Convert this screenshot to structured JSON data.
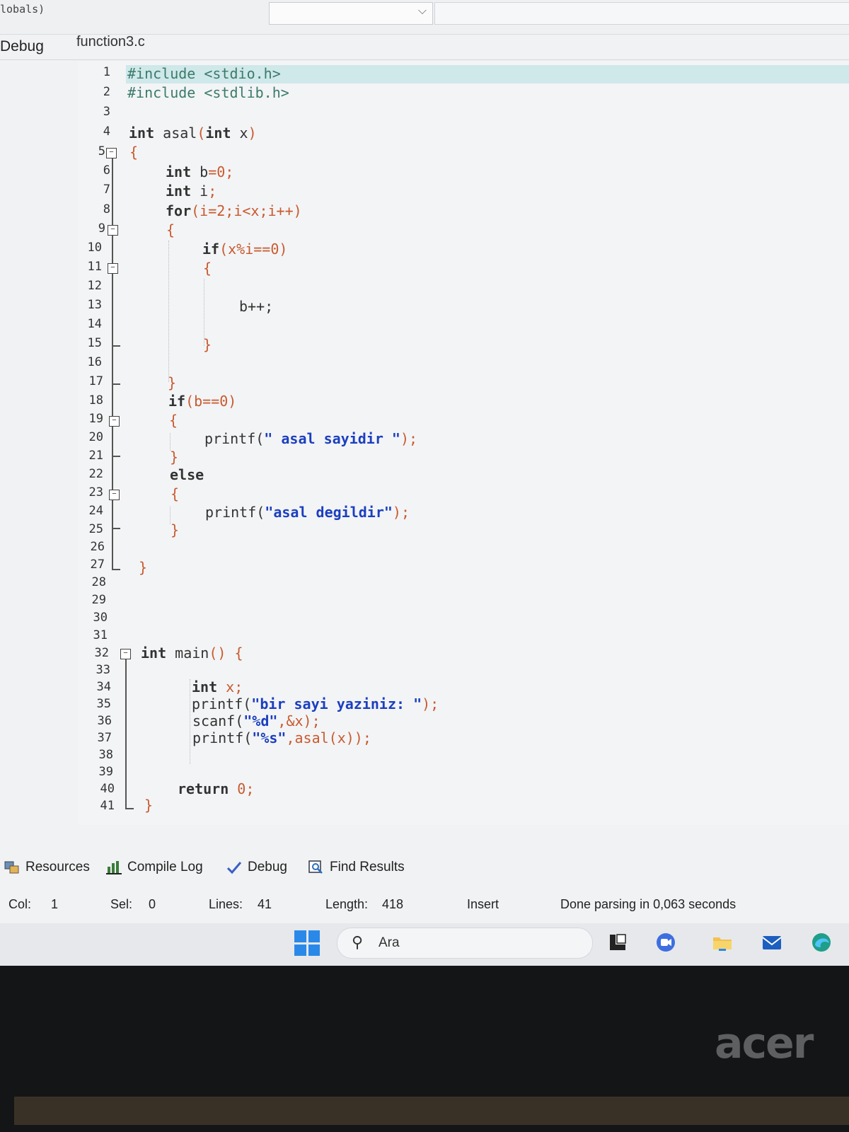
{
  "top": {
    "scope_text": "lobals)",
    "dropdown_arrow": "chevron-down-icon"
  },
  "left_panel": {
    "tab_label": "Debug"
  },
  "editor": {
    "file_tab": "function3.c",
    "line_numbers": [
      "1",
      "2",
      "3",
      "4",
      "5",
      "6",
      "7",
      "8",
      "9",
      "10",
      "11",
      "12",
      "13",
      "14",
      "15",
      "16",
      "17",
      "18",
      "19",
      "20",
      "21",
      "22",
      "23",
      "24",
      "25",
      "26",
      "27",
      "28",
      "29",
      "30",
      "31",
      "32",
      "33",
      "34",
      "35",
      "36",
      "37",
      "38",
      "39",
      "40",
      "41"
    ],
    "code": {
      "l1_pre": "#include <stdio.h>",
      "l2_pre": "#include <stdlib.h>",
      "l4_kw": "int",
      "l4_name": " asal",
      "l4_paren_open": "(",
      "l4_arg_kw": "int",
      "l4_arg": " x",
      "l4_paren_close": ")",
      "brace_open": "{",
      "brace_close": "}",
      "l6_kw": "int",
      "l6_rest": " b",
      "l6_tail": "=0;",
      "l7_kw": "int",
      "l7_rest": " i",
      "l7_tail": ";",
      "l8_kw": "for",
      "l8_rest": "(i=2;i<x;i++)",
      "l10_kw": "if",
      "l10_rest": "(x%i==0)",
      "l13": "b++;",
      "l18_kw": "if",
      "l18_rest": "(b==0)",
      "l20_fn": "printf(",
      "l20_str": "\" asal sayidir \"",
      "l20_end": ");",
      "l22_kw": "else",
      "l24_fn": "printf(",
      "l24_str": "\"asal degildir\"",
      "l24_end": ");",
      "l32_kw": "int",
      "l32_name": " main",
      "l32_rest": "() {",
      "l34_kw": "int",
      "l34_rest": " x;",
      "l35_fn": "printf(",
      "l35_str": "\"bir sayi yaziniz: \"",
      "l35_end": ");",
      "l36_fn": "scanf(",
      "l36_str": "\"%d\"",
      "l36_end": ",&x);",
      "l37_fn": "printf(",
      "l37_str": "\"%s\"",
      "l37_end": ",asal(x));",
      "l40_kw": "return",
      "l40_rest": " 0;"
    }
  },
  "bottom_tabs": [
    {
      "label": "Resources",
      "icon": "resources-icon"
    },
    {
      "label": "Compile Log",
      "icon": "chart-icon"
    },
    {
      "label": "Debug",
      "icon": "check-icon"
    },
    {
      "label": "Find Results",
      "icon": "find-icon"
    }
  ],
  "status": {
    "col_label": "Col:",
    "col_value": "1",
    "sel_label": "Sel:",
    "sel_value": "0",
    "lines_label": "Lines:",
    "lines_value": "41",
    "length_label": "Length:",
    "length_value": "418",
    "mode": "Insert",
    "message": "Done parsing in 0,063 seconds"
  },
  "taskbar": {
    "search_placeholder": "Ara",
    "icons": [
      "start-icon",
      "search-icon",
      "files-icon",
      "meet-icon",
      "file-explorer-icon",
      "mail-icon",
      "edge-icon"
    ]
  },
  "brand": {
    "logo_text": "acer"
  },
  "colors": {
    "string": "#1b3fbf",
    "symbol": "#c85a2e",
    "preprocessor": "#3a7b6a",
    "highlight_line": "#cfe8ea",
    "windows_blue": "#2a89e8"
  }
}
